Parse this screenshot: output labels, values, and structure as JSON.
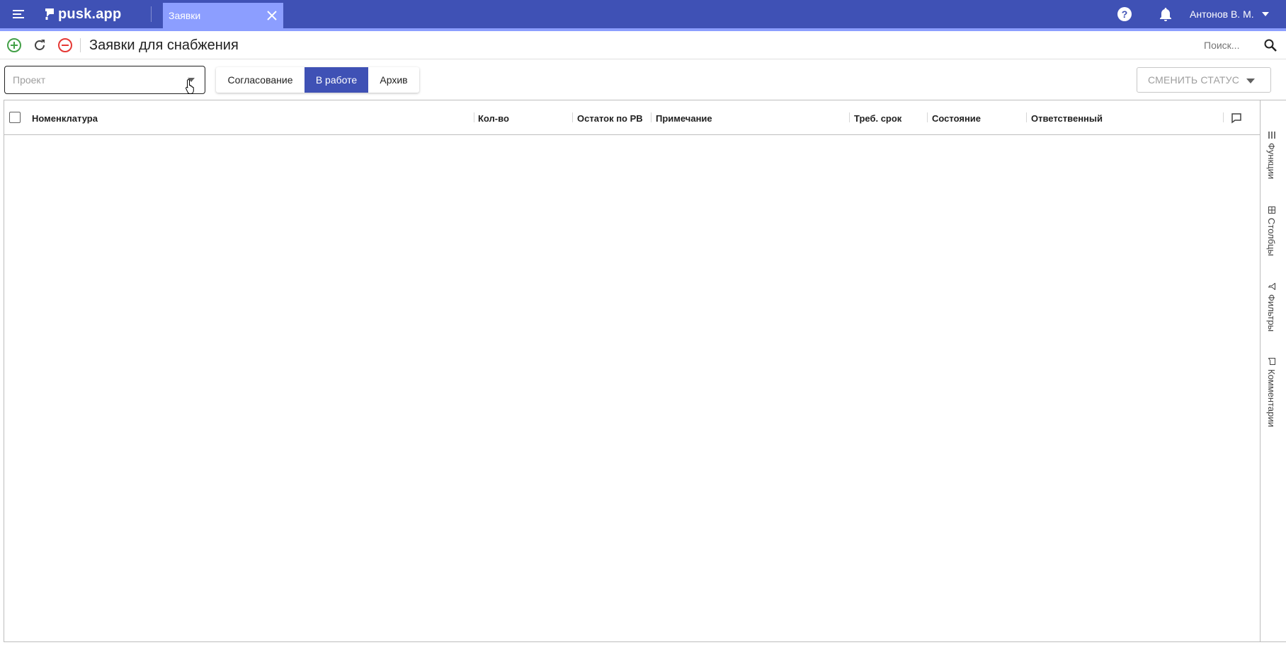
{
  "app": {
    "logo_text": "pusk.app",
    "tab_label": "Заявки",
    "user_name": "Антонов В. М."
  },
  "toolbar": {
    "page_title": "Заявки для снабжения",
    "search_placeholder": "Поиск..."
  },
  "filters": {
    "project_placeholder": "Проект",
    "segments": [
      "Согласование",
      "В работе",
      "Архив"
    ],
    "active_segment": "В работе",
    "change_status_label": "СМЕНИТЬ СТАТУС"
  },
  "grid": {
    "columns": [
      "Номенклатура",
      "Кол-во",
      "Остаток по РВ",
      "Примечание",
      "Треб. срок",
      "Состояние",
      "Ответственный"
    ],
    "rows": []
  },
  "side_panel": {
    "tabs": [
      "Функции",
      "Столбцы",
      "Фильтры",
      "Комментарии"
    ]
  },
  "colors": {
    "primary": "#3f51b5",
    "accent": "#8c9eff",
    "add_green": "#43a047",
    "remove_red": "#e53935"
  },
  "icons": [
    "menu-icon",
    "logo-icon",
    "close-icon",
    "help-icon",
    "bell-icon",
    "chevron-down-icon",
    "add-icon",
    "refresh-icon",
    "remove-icon",
    "search-icon",
    "comment-icon",
    "functions-icon",
    "columns-icon",
    "filter-icon",
    "comments-icon"
  ]
}
